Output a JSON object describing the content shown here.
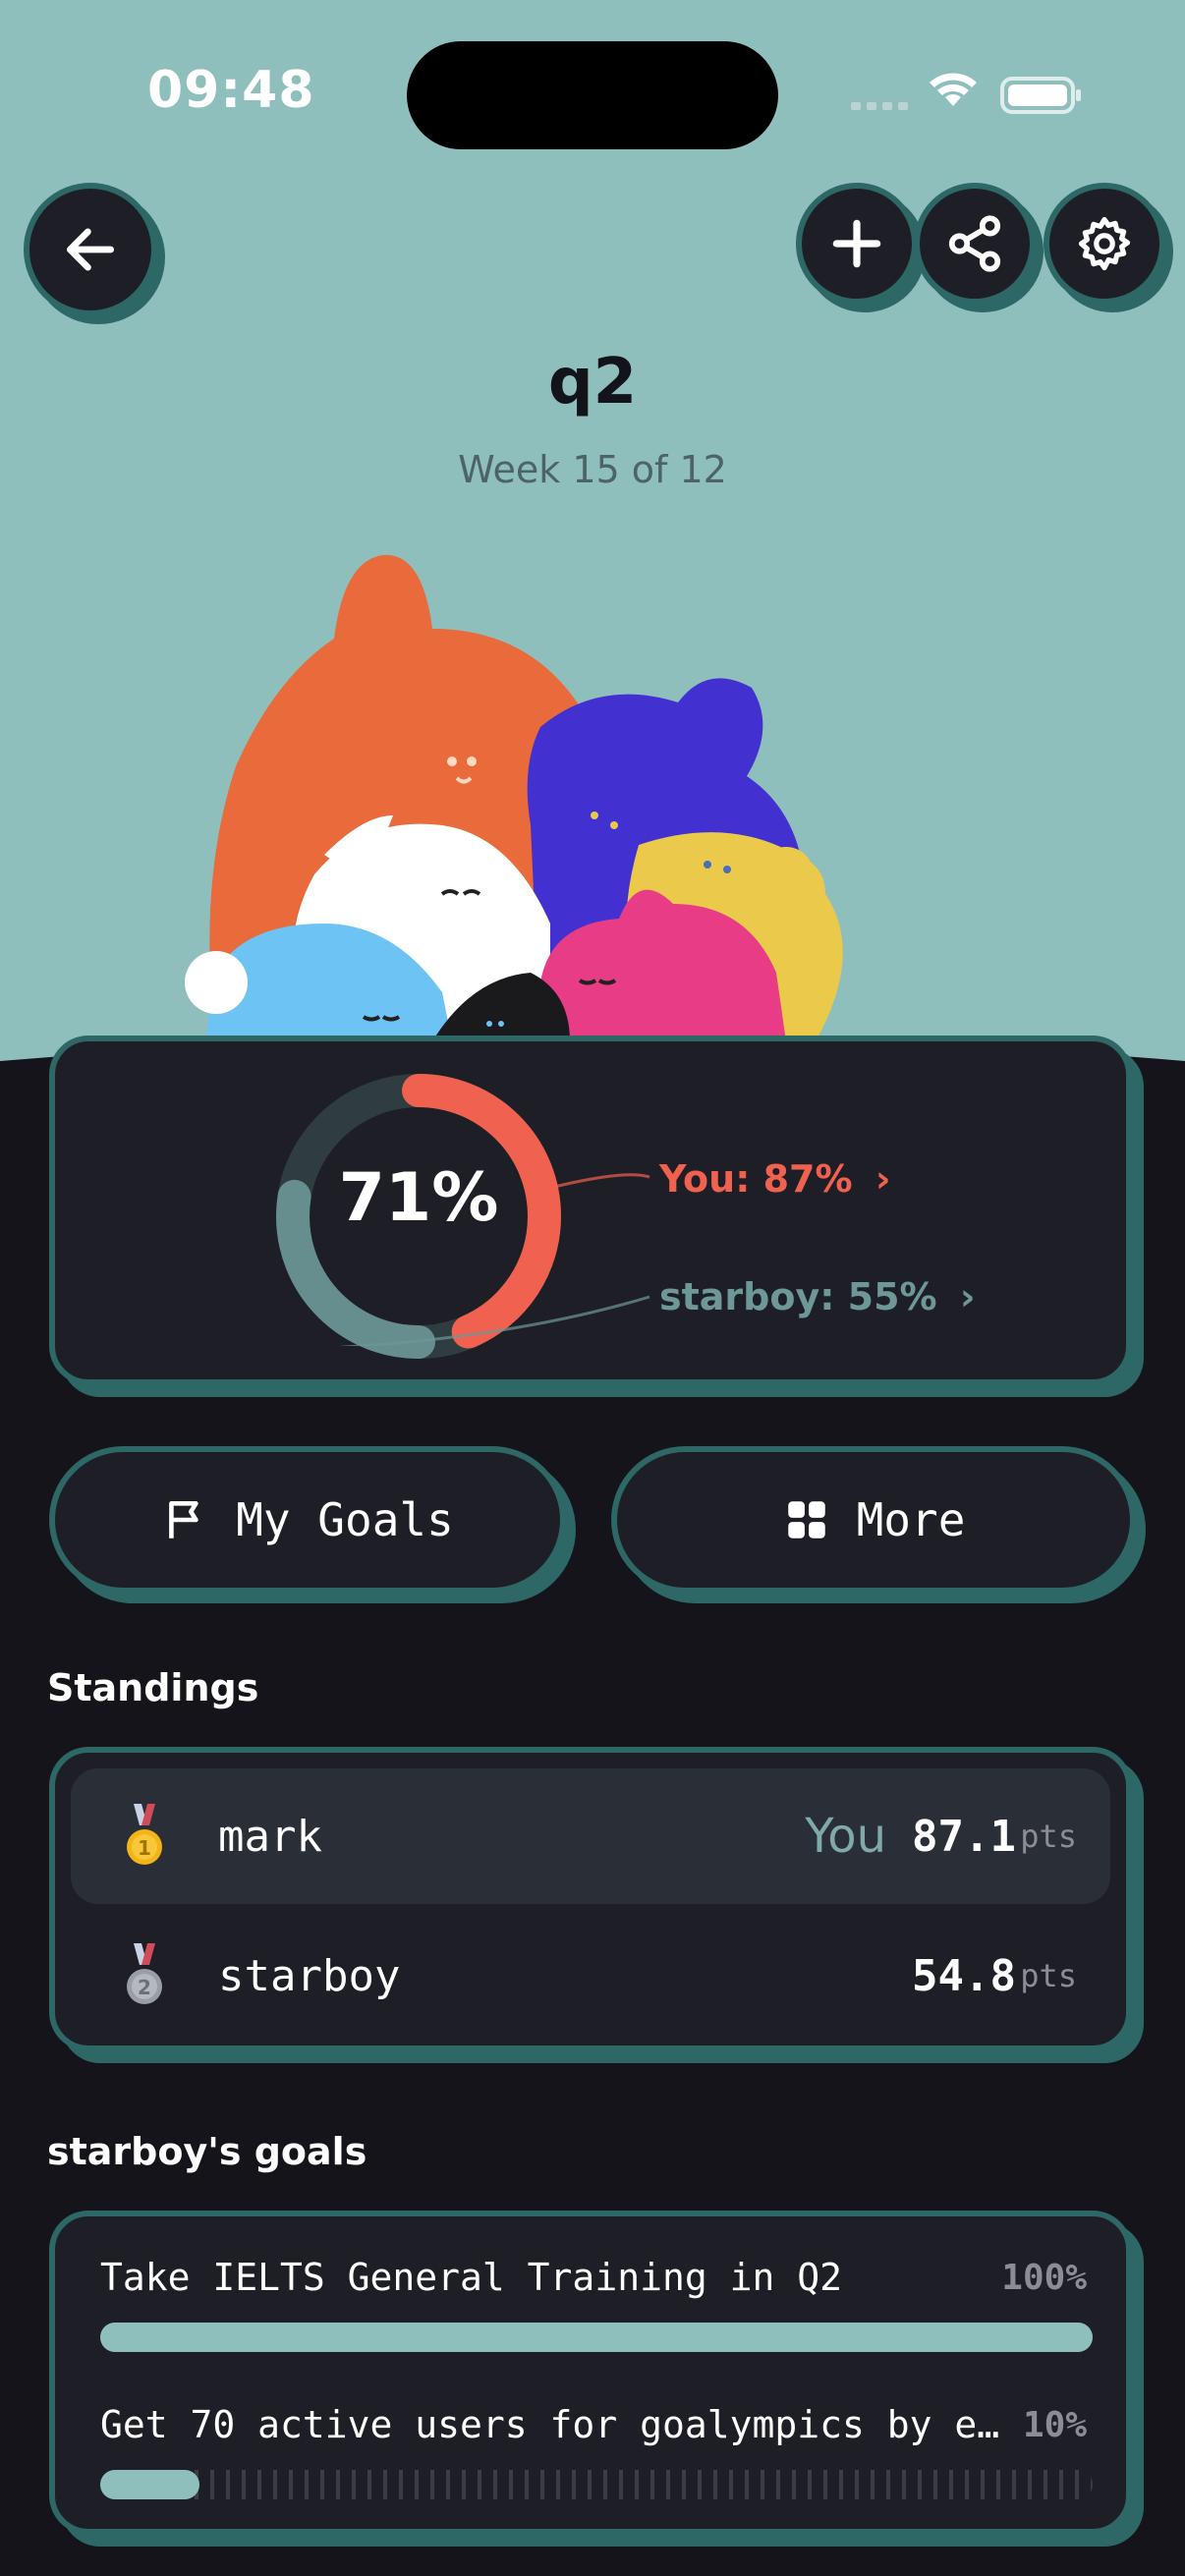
{
  "status_bar": {
    "time": "09:48"
  },
  "header": {
    "title": "q2",
    "subtitle": "Week 15 of 12"
  },
  "progress": {
    "overall_percent_label": "71%",
    "overall_percent": 71,
    "you_label": "You: 87%",
    "you_percent": 87,
    "partner_label": "starboy: 55%",
    "partner_percent": 55,
    "you_color": "#f0614f",
    "partner_color": "#6e9798"
  },
  "actions": {
    "my_goals_label": "My Goals",
    "more_label": "More"
  },
  "standings": {
    "title": "Standings",
    "rows": [
      {
        "rank": "1",
        "name": "mark",
        "you_tag": "You",
        "points": "87.1",
        "unit": "pts"
      },
      {
        "rank": "2",
        "name": "starboy",
        "you_tag": "",
        "points": "54.8",
        "unit": "pts"
      }
    ]
  },
  "goals": {
    "title": "starboy's goals",
    "items": [
      {
        "text": "Take IELTS General Training in Q2",
        "percent_label": "100%",
        "percent": 100
      },
      {
        "text": "Get 70 active users for goalympics by e…",
        "percent_label": "10%",
        "percent": 10
      }
    ]
  },
  "colors": {
    "hero_bg": "#8fbfbd",
    "dark_bg": "#15141a",
    "card_bg": "#1e1f26",
    "card_border": "#2d6766",
    "accent": "#f0614f"
  }
}
